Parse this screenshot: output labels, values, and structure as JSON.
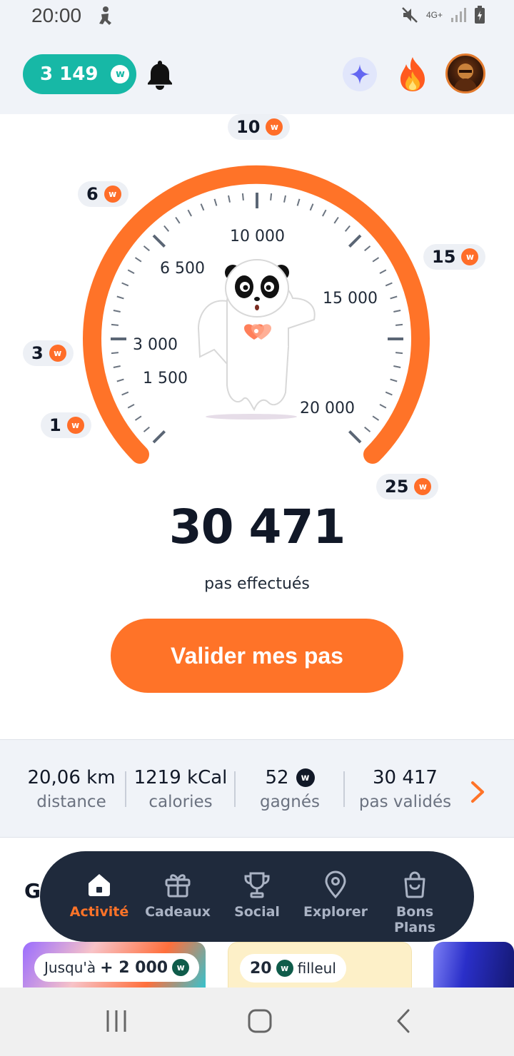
{
  "status_bar": {
    "time": "20:00",
    "network": "4G+"
  },
  "header": {
    "coin_balance": "3 149",
    "coin_badge": "w"
  },
  "gauge": {
    "rewards": [
      {
        "value": "1"
      },
      {
        "value": "3"
      },
      {
        "value": "6"
      },
      {
        "value": "10"
      },
      {
        "value": "15"
      },
      {
        "value": "25"
      }
    ],
    "scale_labels": [
      "1 500",
      "3 000",
      "6 500",
      "10 000",
      "15 000",
      "20 000"
    ],
    "badge_letter": "w"
  },
  "steps": {
    "count": "30 471",
    "caption": "pas effectués"
  },
  "validate_button": "Valider mes pas",
  "stats": {
    "distance": {
      "value": "20,06 km",
      "label": "distance"
    },
    "calories": {
      "value": "1219 kCal",
      "label": "calories"
    },
    "earned": {
      "value": "52",
      "label": "gagnés"
    },
    "validated": {
      "value": "30 417",
      "label": "pas validés"
    }
  },
  "section_title_initial": "G",
  "cards": [
    {
      "prefix": "Jusqu'à",
      "amount": "+ 2 000"
    },
    {
      "amount": "20",
      "suffix": "filleul"
    }
  ],
  "nav": {
    "items": [
      {
        "label": "Activité"
      },
      {
        "label": "Cadeaux"
      },
      {
        "label": "Social"
      },
      {
        "label": "Explorer"
      },
      {
        "label": "Bons Plans"
      }
    ]
  },
  "colors": {
    "accent": "#ff7328",
    "teal": "#17b8a6",
    "nav_bg": "#1f2a3c"
  }
}
